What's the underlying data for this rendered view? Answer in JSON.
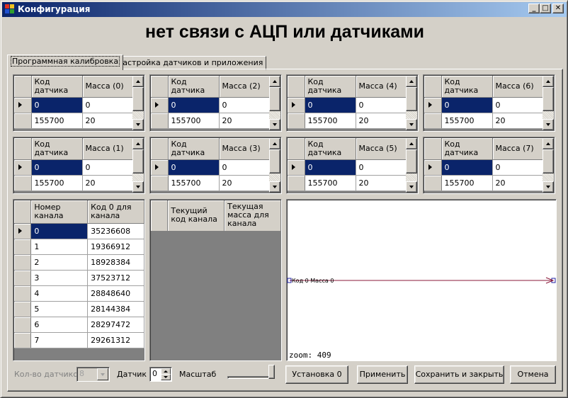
{
  "window": {
    "title": "Конфигурация",
    "minimize_glyph": "_",
    "maximize_glyph": "□",
    "close_glyph": "✕"
  },
  "headline": "нет связи с АЦП или датчиками",
  "tabs": [
    {
      "label": "Программная калибровка",
      "active": true
    },
    {
      "label": "Настройка датчиков и приложения",
      "active": false
    }
  ],
  "sensor_grids": {
    "code_header": "Код датчика",
    "rows": [
      {
        "code": "0",
        "mass": "0"
      },
      {
        "code": "155700",
        "mass": "20"
      }
    ],
    "mass_headers": [
      "Масса (0)",
      "Масса (2)",
      "Масса (4)",
      "Масса (6)",
      "Масса (1)",
      "Масса (3)",
      "Масса (5)",
      "Масса (7)"
    ]
  },
  "channel_grid": {
    "headers": [
      "Номер канала",
      "Код 0 для канала"
    ],
    "rows": [
      [
        "0",
        "35236608"
      ],
      [
        "1",
        "19366912"
      ],
      [
        "2",
        "18928384"
      ],
      [
        "3",
        "37523712"
      ],
      [
        "4",
        "28848640"
      ],
      [
        "5",
        "28144384"
      ],
      [
        "6",
        "28297472"
      ],
      [
        "7",
        "29261312"
      ]
    ]
  },
  "current_grid": {
    "headers": [
      "Текущий код канала",
      "Текущая масса для канала"
    ]
  },
  "plot": {
    "series_label": "Код 0 Масса 0",
    "zoom_text": "zoom: 409",
    "line_color": "#8b1a3a"
  },
  "controls": {
    "sensor_count_label": "Кол-во датчиков",
    "sensor_count_value": "8",
    "sensor_label": "Датчик",
    "sensor_value": "0",
    "scale_label": "Масштаб",
    "buttons": {
      "set_zero": "Установка 0",
      "apply": "Применить",
      "save_close": "Сохранить и закрыть",
      "cancel": "Отмена"
    }
  },
  "colors": {
    "selection": "#0a246a",
    "title_gradient_start": "#0a246a",
    "face": "#d4d0c8",
    "grid_background": "#808080"
  }
}
